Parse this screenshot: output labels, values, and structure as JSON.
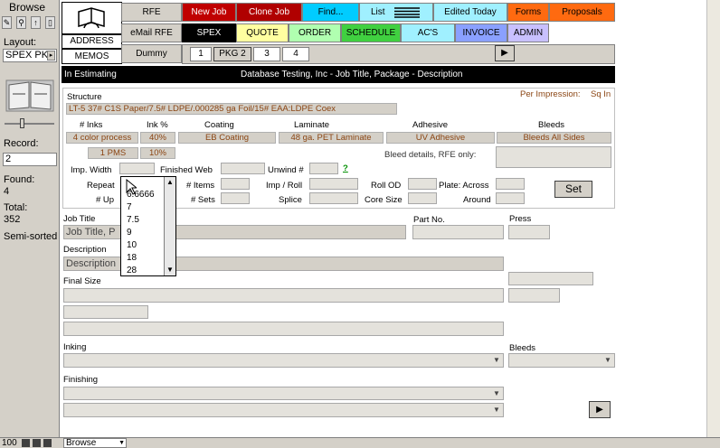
{
  "left": {
    "mode": "Browse",
    "layout_label": "Layout:",
    "layout_value": "SPEX PK",
    "record_label": "Record:",
    "record_value": "2",
    "found_label": "Found:",
    "found_value": "4",
    "total_label": "Total:",
    "total_value": "352",
    "sort_status": "Semi-sorted"
  },
  "bottom": {
    "zoom": "100",
    "mode_select": "Browse"
  },
  "nav": {
    "address": "ADDRESS",
    "memos": "MEMOS",
    "rfe": "RFE",
    "email_rfe": "eMail RFE",
    "dummy": "Dummy",
    "new_job": "New Job",
    "clone_job": "Clone Job",
    "find": "Find...",
    "list": "List",
    "edited_today": "Edited Today",
    "forms": "Forms",
    "proposals": "Proposals",
    "spex": "SPEX",
    "quote": "QUOTE",
    "order": "ORDER",
    "schedule": "SCHEDULE",
    "acs": "AC'S",
    "invoice": "INVOICE",
    "admin": "ADMIN",
    "pkg1": "1",
    "pkg2": "PKG 2",
    "pkg3": "3",
    "pkg4": "4"
  },
  "colors": {
    "darkred": "#c00000",
    "red_btn": "#b00000",
    "cyan": "#00ccff",
    "lightcyan": "#a0f0ff",
    "orange": "#ff6a10",
    "yellow": "#ffffa0",
    "lightgreen": "#b0ffb0",
    "green": "#40d040",
    "blue": "#8aa0ff",
    "lavender": "#c8c0ff",
    "brown_text": "#8b4513"
  },
  "status_bar": {
    "left": "In Estimating",
    "center": "Database Testing, Inc  -  Job Title, Package  -  Description"
  },
  "structure": {
    "label": "Structure",
    "per_impression": "Per Impression:",
    "unit": "Sq In",
    "value": "LT-5  37# C1S Paper/7.5# LDPE/.000285 ga Foil/15# EAA:LDPE Coex",
    "col_inks": "# Inks",
    "col_ink_pct": "Ink %",
    "col_coating": "Coating",
    "col_laminate": "Laminate",
    "col_adhesive": "Adhesive",
    "col_bleeds": "Bleeds",
    "inks": "4 color process",
    "ink_pct": "40%",
    "coating": "EB Coating",
    "laminate": "48 ga. PET Laminate",
    "adhesive": "UV Adhesive",
    "bleeds": "Bleeds All Sides",
    "pms": "1 PMS",
    "pms_pct": "10%",
    "bleed_details": "Bleed details, RFE only:",
    "imp_width": "Imp. Width",
    "finished_web": "Finished Web",
    "unwind": "Unwind #",
    "help": "?",
    "repeat": "Repeat",
    "items": "# Items",
    "imp_roll": "Imp / Roll",
    "roll_od": "Roll OD",
    "plate_across": "Plate: Across",
    "up": "# Up",
    "sets": "# Sets",
    "splice": "Splice",
    "core_size": "Core Size",
    "around": "Around",
    "set_button": "Set"
  },
  "popup": {
    "items": [
      "6.6666",
      "7",
      "7.5",
      "9",
      "10",
      "18",
      "28"
    ]
  },
  "job": {
    "job_title_label": "Job Title",
    "job_title_value": "Job Title, P",
    "part_no": "Part No.",
    "press": "Press",
    "description_label": "Description",
    "description_value": "Description",
    "final_size": "Final Size",
    "inking": "Inking",
    "bleeds": "Bleeds",
    "finishing": "Finishing"
  }
}
